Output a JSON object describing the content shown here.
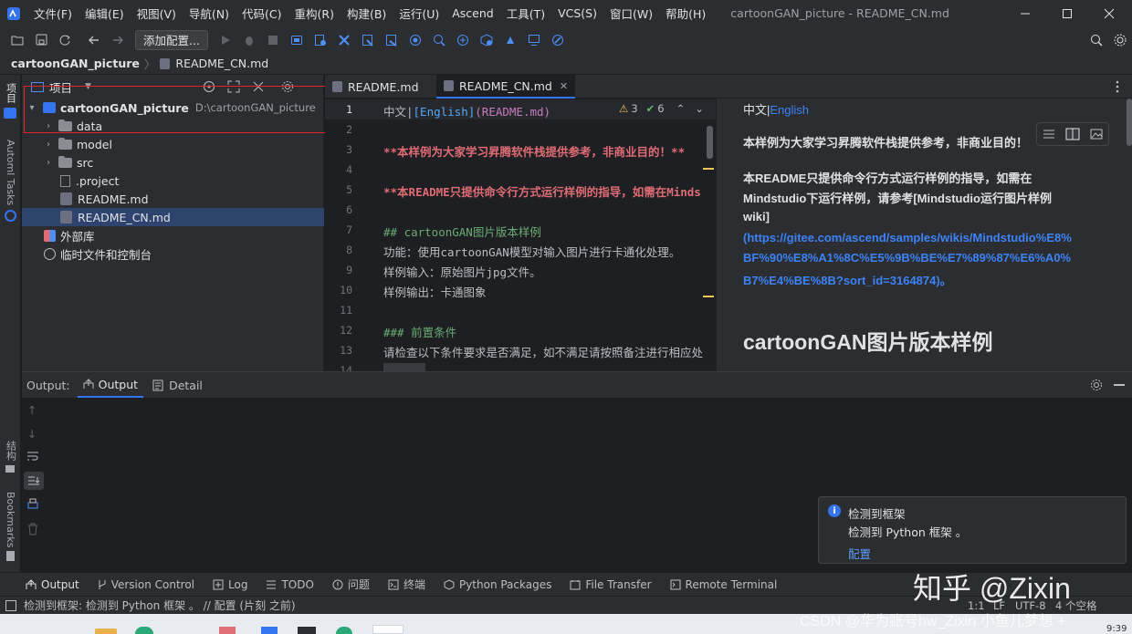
{
  "menubar": {
    "items": [
      "文件(F)",
      "编辑(E)",
      "视图(V)",
      "导航(N)",
      "代码(C)",
      "重构(R)",
      "构建(B)",
      "运行(U)",
      "Ascend",
      "工具(T)",
      "VCS(S)",
      "窗口(W)",
      "帮助(H)"
    ],
    "window_title": "cartoonGAN_picture - README_CN.md"
  },
  "toolbar": {
    "run_config": "添加配置..."
  },
  "navbar": {
    "project": "cartoonGAN_picture",
    "file": "README_CN.md"
  },
  "left_strip": {
    "project": "项目",
    "tasks": "Automl Tasks",
    "structure": "结构",
    "bookmarks": "Bookmarks"
  },
  "project": {
    "title": "项目",
    "root_name": "cartoonGAN_picture",
    "root_path": "D:\\cartoonGAN_picture",
    "items": [
      {
        "name": "data"
      },
      {
        "name": "model"
      },
      {
        "name": "src"
      },
      {
        "name": ".project"
      },
      {
        "name": "README.md"
      },
      {
        "name": "README_CN.md"
      },
      {
        "name": "外部库"
      },
      {
        "name": "临时文件和控制台"
      }
    ]
  },
  "editor": {
    "tabs": [
      {
        "label": "README.md"
      },
      {
        "label": "README_CN.md"
      }
    ],
    "warnings": "3",
    "checks": "6",
    "line_numbers": [
      "1",
      "2",
      "3",
      "4",
      "5",
      "6",
      "7",
      "8",
      "9",
      "10",
      "11",
      "12",
      "13",
      "14"
    ],
    "lines": {
      "l1_a": "中文|",
      "l1_b": "[English]",
      "l1_c": "(README.md)",
      "l3": "**本样例为大家学习昇腾软件栈提供参考，非商业目的！**",
      "l5": "**本README只提供命令行方式运行样例的指导，如需在Minds",
      "l7": "## cartoonGAN图片版本样例",
      "l8": "功能：使用cartoonGAN模型对输入图片进行卡通化处理。",
      "l9": "样例输入：原始图片jpg文件。",
      "l10": "样例输出：卡通图象",
      "l12": "### 前置条件",
      "l13": "请检查以下条件要求是否满足，如不满足请按照备注进行相应处"
    }
  },
  "preview": {
    "lang_a": "中文|",
    "lang_b": "English",
    "p1": "本样例为大家学习昇腾软件栈提供参考，非商业目的！",
    "p2_1": "本README只提供命令行方式运行样例的指导，如需在",
    "p2_2": "Mindstudio下运行样例，请参考[Mindstudio运行图片样例",
    "p2_3": "wiki]",
    "link1": "(https://gitee.com/ascend/samples/wikis/Mindstudio%E8%",
    "link2": "BF%90%E8%A1%8C%E5%9B%BE%E7%89%87%E6%A0%",
    "link3": "B7%E4%BE%8B?sort_id=3164874)。",
    "heading": "cartoonGAN图片版本样例"
  },
  "output": {
    "label": "Output:",
    "tab_output": "Output",
    "tab_detail": "Detail"
  },
  "notification": {
    "title": "检测到框架",
    "body": "检测到 Python 框架 。",
    "action": "配置"
  },
  "bottom_tabs": [
    "Output",
    "Version Control",
    "Log",
    "TODO",
    "问题",
    "终端",
    "Python Packages",
    "File Transfer",
    "Remote Terminal"
  ],
  "statusbar": {
    "message": "检测到框架: 检测到 Python 框架 。 // 配置 (片刻 之前)",
    "position": "1:1",
    "line_sep": "LF",
    "encoding": "UTF-8",
    "indent": "4 个空格"
  },
  "watermark": {
    "zhihu": "知乎 @Zixin",
    "csdn": "CSDN @华为账号hw_Zixin 小鱼儿梦想 +"
  },
  "clock": "9:39",
  "colors": {
    "accent": "#3574f0",
    "highlight_box": "#e0262b",
    "bold_red": "#e06c75",
    "link": "#3c83f8",
    "heading_green": "#6aab73"
  }
}
